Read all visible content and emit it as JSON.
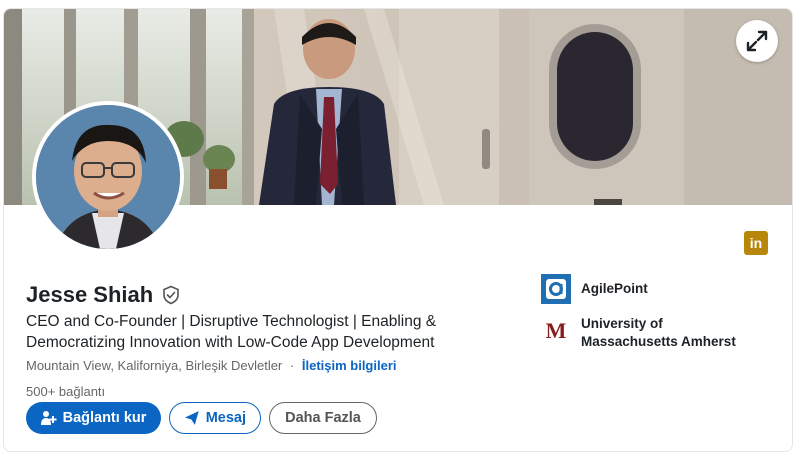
{
  "profile": {
    "name": "Jesse Shiah",
    "headline": "CEO and Co-Founder | Disruptive Technologist | Enabling & Democratizing Innovation with Low-Code App Development",
    "location": "Mountain View, Kaliforniya, Birleşik Devletler",
    "separator": "·",
    "contact_info": "İletişim bilgileri",
    "connections": "500+ bağlantı"
  },
  "actions": {
    "connect": "Bağlantı kur",
    "message": "Mesaj",
    "more": "Daha Fazla"
  },
  "experience": [
    {
      "name": "AgilePoint"
    },
    {
      "name": "University of Massachusetts Amherst"
    }
  ],
  "badge": {
    "text": "in"
  },
  "colors": {
    "primary": "#0a66c2",
    "linkedin_badge": "#b8860b",
    "umass_maroon": "#881c1c",
    "agilepoint_blue": "#1f6fb2"
  },
  "icons": {
    "expand": "expand-arrows-icon",
    "verified": "shield-check-icon",
    "connect": "add-person-icon",
    "message": "paper-plane-icon"
  }
}
